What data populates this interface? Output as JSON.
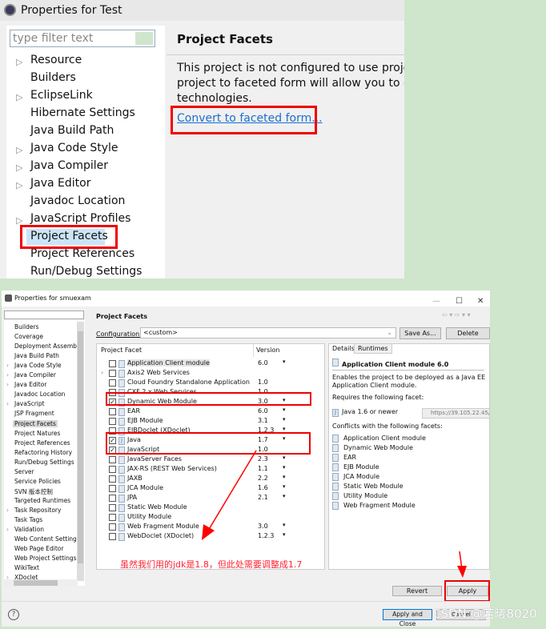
{
  "top": {
    "title": "Properties for Test",
    "filter_placeholder": "type filter text",
    "tree": [
      {
        "label": "Resource",
        "expandable": true
      },
      {
        "label": "Builders",
        "expandable": false
      },
      {
        "label": "EclipseLink",
        "expandable": true
      },
      {
        "label": "Hibernate Settings",
        "expandable": false
      },
      {
        "label": "Java Build Path",
        "expandable": false
      },
      {
        "label": "Java Code Style",
        "expandable": true
      },
      {
        "label": "Java Compiler",
        "expandable": true
      },
      {
        "label": "Java Editor",
        "expandable": true
      },
      {
        "label": "Javadoc Location",
        "expandable": false
      },
      {
        "label": "JavaScript Profiles",
        "expandable": true
      },
      {
        "label": "Project Facets",
        "expandable": false,
        "selected": true
      },
      {
        "label": "Project References",
        "expandable": false
      },
      {
        "label": "Run/Debug Settings",
        "expandable": false
      }
    ],
    "heading": "Project Facets",
    "description": [
      "This project is not configured to use project",
      "project to faceted form will allow you to easi",
      "technologies."
    ],
    "convert_link": "Convert to faceted form..."
  },
  "bottom": {
    "title": "Properties for smuexam",
    "window_controls": {
      "minimize": "—",
      "maximize": "☐",
      "close": "✕"
    },
    "tree": [
      {
        "label": "Builders"
      },
      {
        "label": "Coverage"
      },
      {
        "label": "Deployment Assembly"
      },
      {
        "label": "Java Build Path"
      },
      {
        "label": "Java Code Style",
        "expandable": true
      },
      {
        "label": "Java Compiler",
        "expandable": true
      },
      {
        "label": "Java Editor",
        "expandable": true
      },
      {
        "label": "Javadoc Location"
      },
      {
        "label": "JavaScript",
        "expandable": true
      },
      {
        "label": "JSP Fragment"
      },
      {
        "label": "Project Facets",
        "selected": true
      },
      {
        "label": "Project Natures"
      },
      {
        "label": "Project References"
      },
      {
        "label": "Refactoring History"
      },
      {
        "label": "Run/Debug Settings"
      },
      {
        "label": "Server"
      },
      {
        "label": "Service Policies"
      },
      {
        "label": "SVN 版本控制"
      },
      {
        "label": "Targeted Runtimes"
      },
      {
        "label": "Task Repository",
        "expandable": true
      },
      {
        "label": "Task Tags"
      },
      {
        "label": "Validation",
        "expandable": true
      },
      {
        "label": "Web Content Settings"
      },
      {
        "label": "Web Page Editor"
      },
      {
        "label": "Web Project Settings"
      },
      {
        "label": "WikiText"
      },
      {
        "label": "XDoclet",
        "expandable": true
      }
    ],
    "heading": "Project Facets",
    "configuration_label": "Configuration:",
    "configuration_value": "<custom>",
    "save_as": "Save As...",
    "delete": "Delete",
    "col_facet": "Project Facet",
    "col_version": "Version",
    "facets": [
      {
        "name": "Application Client module",
        "version": "6.0",
        "checked": false,
        "dropdown": true,
        "highlight": true
      },
      {
        "name": "Axis2 Web Services",
        "version": "",
        "checked": false,
        "dropdown": false,
        "expandable": true
      },
      {
        "name": "Cloud Foundry Standalone Application",
        "version": "1.0",
        "checked": false,
        "dropdown": false
      },
      {
        "name": "CXF 2.x Web Services",
        "version": "1.0",
        "checked": false,
        "dropdown": false
      },
      {
        "name": "Dynamic Web Module",
        "version": "3.0",
        "checked": true,
        "dropdown": true
      },
      {
        "name": "EAR",
        "version": "6.0",
        "checked": false,
        "dropdown": true
      },
      {
        "name": "EJB Module",
        "version": "3.1",
        "checked": false,
        "dropdown": true
      },
      {
        "name": "EJBDoclet (XDoclet)",
        "version": "1.2.3",
        "checked": false,
        "dropdown": true
      },
      {
        "name": "Java",
        "version": "1.7",
        "checked": true,
        "dropdown": true
      },
      {
        "name": "JavaScript",
        "version": "1.0",
        "checked": true,
        "dropdown": false
      },
      {
        "name": "JavaServer Faces",
        "version": "2.3",
        "checked": false,
        "dropdown": true
      },
      {
        "name": "JAX-RS (REST Web Services)",
        "version": "1.1",
        "checked": false,
        "dropdown": true
      },
      {
        "name": "JAXB",
        "version": "2.2",
        "checked": false,
        "dropdown": true
      },
      {
        "name": "JCA Module",
        "version": "1.6",
        "checked": false,
        "dropdown": true
      },
      {
        "name": "JPA",
        "version": "2.1",
        "checked": false,
        "dropdown": true
      },
      {
        "name": "Static Web Module",
        "version": "",
        "checked": false,
        "dropdown": false
      },
      {
        "name": "Utility Module",
        "version": "",
        "checked": false,
        "dropdown": false
      },
      {
        "name": "Web Fragment Module",
        "version": "3.0",
        "checked": false,
        "dropdown": true
      },
      {
        "name": "WebDoclet (XDoclet)",
        "version": "1.2.3",
        "checked": false,
        "dropdown": true
      }
    ],
    "tabs": [
      "Details",
      "Runtimes"
    ],
    "details": {
      "title": "Application Client module 6.0",
      "description": [
        "Enables the project to be deployed as a Java EE",
        "Application Client module."
      ],
      "requires_label": "Requires the following facet:",
      "requires": "Java 1.6 or newer",
      "conflicts_label": "Conflicts with the following facets:",
      "conflicts": [
        "Application Client module",
        "Dynamic Web Module",
        "EAR",
        "EJB Module",
        "JCA Module",
        "Static Web Module",
        "Utility Module",
        "Web Fragment Module"
      ]
    },
    "tooltip_url": "https://39.105.22.45/",
    "annotation": "虽然我们用的jdk是1.8，但此处需要调整成1.7",
    "revert": "Revert",
    "apply": "Apply",
    "apply_and_close": "Apply and Close",
    "cancel": "Cancel",
    "help": "?"
  },
  "watermark": "CSDN @若曦8020",
  "colors": {
    "highlight_red": "#ee0000",
    "link": "#1a6fd0",
    "background": "#cfe6cc"
  }
}
